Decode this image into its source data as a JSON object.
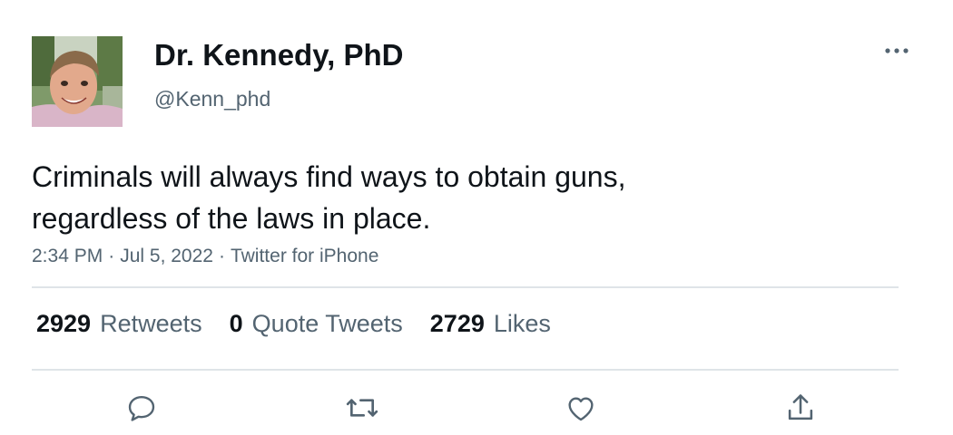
{
  "author": {
    "display_name": "Dr. Kennedy, PhD",
    "handle": "@Kenn_phd",
    "avatar_description_icon": "profile-photo"
  },
  "tweet": {
    "text_lines": [
      "Criminals will always find ways to obtain guns,",
      "regardless of the laws in place."
    ],
    "time": "2:34 PM",
    "date": "Jul 5, 2022",
    "source": "Twitter for iPhone",
    "separator": "·"
  },
  "stats": {
    "retweets_count": "2929",
    "retweets_label": "Retweets",
    "quote_tweets_count": "0",
    "quote_tweets_label": "Quote Tweets",
    "likes_count": "2729",
    "likes_label": "Likes"
  },
  "actions": [
    {
      "icon": "reply-icon"
    },
    {
      "icon": "retweet-icon"
    },
    {
      "icon": "like-icon"
    },
    {
      "icon": "share-icon"
    }
  ],
  "colors": {
    "primary_text": "#0f1419",
    "secondary_text": "#536471",
    "divider": "#dfe4e8"
  }
}
